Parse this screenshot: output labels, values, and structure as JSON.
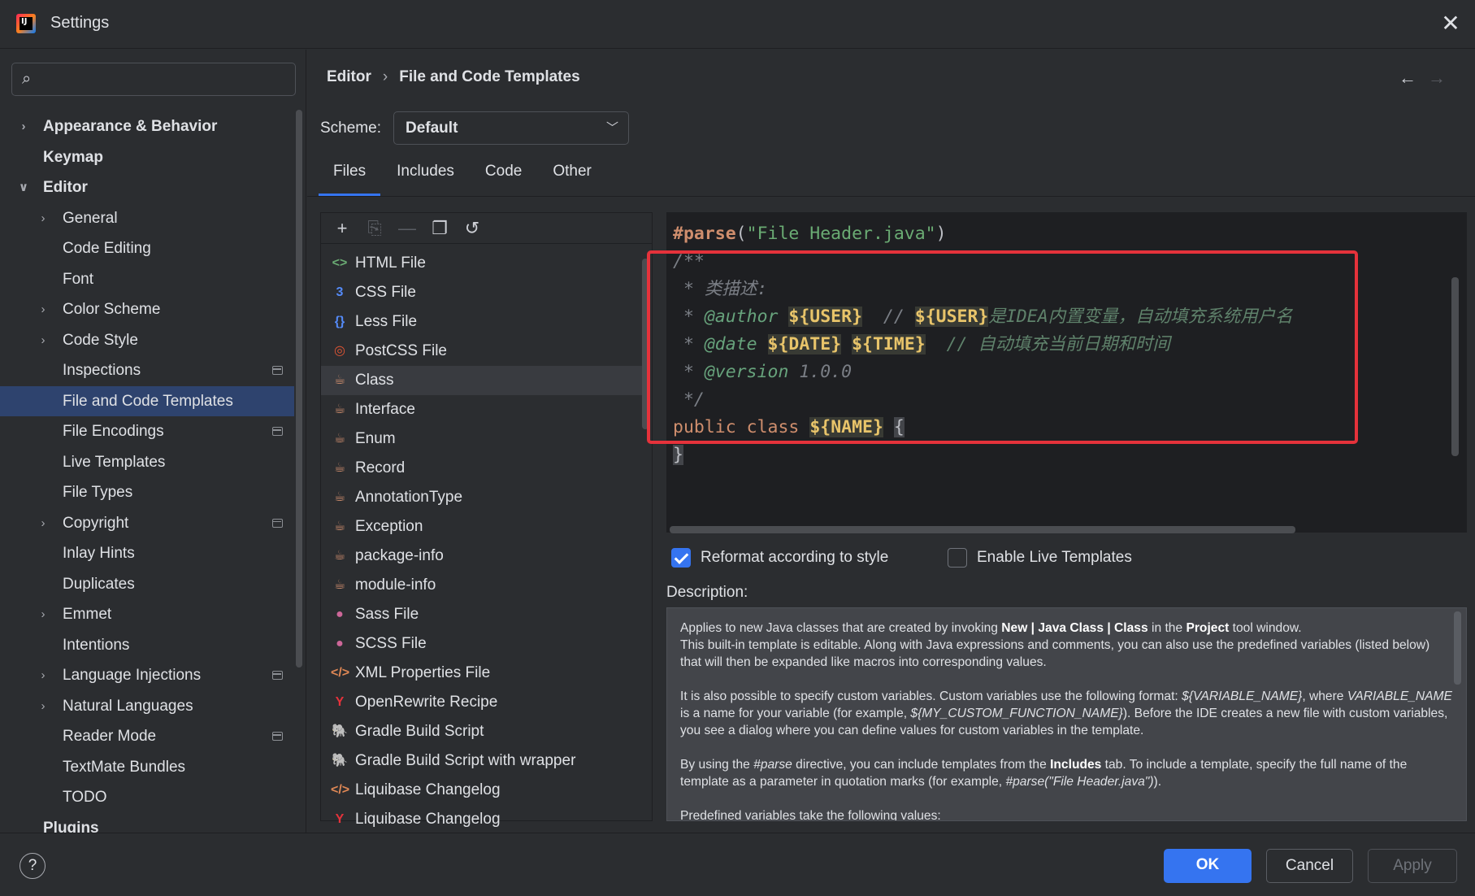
{
  "window": {
    "title": "Settings"
  },
  "search": {
    "placeholder": "",
    "value": ""
  },
  "sidebar": {
    "items": [
      {
        "label": "Appearance & Behavior",
        "level": 0,
        "expandable": true,
        "expanded": false,
        "bold": true
      },
      {
        "label": "Keymap",
        "level": 0,
        "expandable": false,
        "bold": true
      },
      {
        "label": "Editor",
        "level": 0,
        "expandable": true,
        "expanded": true,
        "bold": true
      },
      {
        "label": "General",
        "level": 1,
        "expandable": true
      },
      {
        "label": "Code Editing",
        "level": 1
      },
      {
        "label": "Font",
        "level": 1
      },
      {
        "label": "Color Scheme",
        "level": 1,
        "expandable": true
      },
      {
        "label": "Code Style",
        "level": 1,
        "expandable": true
      },
      {
        "label": "Inspections",
        "level": 1,
        "project_icon": true
      },
      {
        "label": "File and Code Templates",
        "level": 1,
        "selected": true
      },
      {
        "label": "File Encodings",
        "level": 1,
        "project_icon": true
      },
      {
        "label": "Live Templates",
        "level": 1
      },
      {
        "label": "File Types",
        "level": 1
      },
      {
        "label": "Copyright",
        "level": 1,
        "expandable": true,
        "project_icon": true
      },
      {
        "label": "Inlay Hints",
        "level": 1
      },
      {
        "label": "Duplicates",
        "level": 1
      },
      {
        "label": "Emmet",
        "level": 1,
        "expandable": true
      },
      {
        "label": "Intentions",
        "level": 1
      },
      {
        "label": "Language Injections",
        "level": 1,
        "expandable": true,
        "project_icon": true
      },
      {
        "label": "Natural Languages",
        "level": 1,
        "expandable": true
      },
      {
        "label": "Reader Mode",
        "level": 1,
        "project_icon": true
      },
      {
        "label": "TextMate Bundles",
        "level": 1
      },
      {
        "label": "TODO",
        "level": 1
      },
      {
        "label": "Plugins",
        "level": 0,
        "bold": true
      }
    ]
  },
  "breadcrumb": {
    "parent": "Editor",
    "separator": "›",
    "current": "File and Code Templates"
  },
  "scheme": {
    "label": "Scheme:",
    "value": "Default"
  },
  "tabs": [
    {
      "label": "Files",
      "active": true
    },
    {
      "label": "Includes"
    },
    {
      "label": "Code"
    },
    {
      "label": "Other"
    }
  ],
  "toolbar_icons": [
    "add-icon",
    "copy-template-icon",
    "remove-icon",
    "duplicate-icon",
    "reset-icon"
  ],
  "templates": [
    {
      "name": "HTML File",
      "icon": "html-icon",
      "glyph": "<>",
      "color": "#6aab73"
    },
    {
      "name": "CSS File",
      "icon": "css-icon",
      "glyph": "3",
      "color": "#548af7"
    },
    {
      "name": "Less File",
      "icon": "less-icon",
      "glyph": "{}",
      "color": "#548af7"
    },
    {
      "name": "PostCSS File",
      "icon": "postcss-icon",
      "glyph": "◎",
      "color": "#e05534"
    },
    {
      "name": "Class",
      "icon": "java-cup-icon",
      "glyph": "☕",
      "color": "#cf8e6d",
      "selected": true
    },
    {
      "name": "Interface",
      "icon": "java-cup-icon",
      "glyph": "☕",
      "color": "#cf8e6d"
    },
    {
      "name": "Enum",
      "icon": "java-cup-icon",
      "glyph": "☕",
      "color": "#cf8e6d"
    },
    {
      "name": "Record",
      "icon": "java-cup-icon",
      "glyph": "☕",
      "color": "#cf8e6d"
    },
    {
      "name": "AnnotationType",
      "icon": "java-cup-icon",
      "glyph": "☕",
      "color": "#cf8e6d"
    },
    {
      "name": "Exception",
      "icon": "java-cup-icon",
      "glyph": "☕",
      "color": "#cf8e6d"
    },
    {
      "name": "package-info",
      "icon": "java-cup-icon",
      "glyph": "☕",
      "color": "#cf8e6d"
    },
    {
      "name": "module-info",
      "icon": "java-cup-icon",
      "glyph": "☕",
      "color": "#cf8e6d"
    },
    {
      "name": "Sass File",
      "icon": "sass-icon",
      "glyph": "●",
      "color": "#cd6799"
    },
    {
      "name": "SCSS File",
      "icon": "scss-icon",
      "glyph": "●",
      "color": "#cd6799"
    },
    {
      "name": "XML Properties File",
      "icon": "xml-icon",
      "glyph": "</>",
      "color": "#e08855"
    },
    {
      "name": "OpenRewrite Recipe",
      "icon": "openrewrite-icon",
      "glyph": "Y",
      "color": "#e5323b"
    },
    {
      "name": "Gradle Build Script",
      "icon": "gradle-icon",
      "glyph": "🐘",
      "color": "#bcbec4"
    },
    {
      "name": "Gradle Build Script with wrapper",
      "icon": "gradle-icon",
      "glyph": "🐘",
      "color": "#bcbec4"
    },
    {
      "name": "Liquibase Changelog",
      "icon": "xml-icon",
      "glyph": "</>",
      "color": "#e08855"
    },
    {
      "name": "Liquibase Changelog",
      "icon": "liquibase-icon",
      "glyph": "Y",
      "color": "#e5323b"
    }
  ],
  "code": {
    "line1": {
      "directive": "#parse",
      "open": "(",
      "string": "\"File Header.java\"",
      "close": ")"
    },
    "line2": "/**",
    "line3": " * 类描述:",
    "line4": {
      "prefix": " * ",
      "tag": "@author",
      "var1": "${USER}",
      "mid": "  // ",
      "var2": "${USER}",
      "comment": "是IDEA内置变量，自动填充系统用户名"
    },
    "line5": {
      "prefix": " * ",
      "tag": "@date",
      "var1": "${DATE}",
      "var2": "${TIME}",
      "comment": "  // 自动填充当前日期和时间"
    },
    "line6": {
      "prefix": " * ",
      "tag": "@version",
      "value": " 1.0.0"
    },
    "line7": " */",
    "line8": {
      "kw1": "public",
      "kw2": "class",
      "var": "${NAME}",
      "brace": "{"
    },
    "line9": "}"
  },
  "options": {
    "reformat": {
      "label": "Reformat according to style",
      "checked": true
    },
    "live_templates": {
      "label": "Enable Live Templates",
      "checked": false
    }
  },
  "description": {
    "label": "Description:",
    "p1a": "Applies to new Java classes that are created by invoking ",
    "p1b": "New | Java Class | Class",
    "p1c": " in the ",
    "p1d": "Project",
    "p1e": " tool window.",
    "p1f": "This built-in template is editable. Along with Java expressions and comments, you can also use the predefined variables (listed below) that will then be expanded like macros into corresponding values.",
    "p2a": "It is also possible to specify custom variables. Custom variables use the following format: ",
    "p2b": "${VARIABLE_NAME}",
    "p2c": ", where ",
    "p2d": "VARIABLE_NAME",
    "p2e": " is a name for your variable (for example, ",
    "p2f": "${MY_CUSTOM_FUNCTION_NAME}",
    "p2g": "). Before the IDE creates a new file with custom variables, you see a dialog where you can define values for custom variables in the template.",
    "p3a": "By using the ",
    "p3b": "#parse",
    "p3c": " directive, you can include templates from the ",
    "p3d": "Includes",
    "p3e": " tab. To include a template, specify the full name of the template as a parameter in quotation marks (for example, ",
    "p3f": "#parse(\"File Header.java\")",
    "p3g": ").",
    "p4": "Predefined variables take the following values:"
  },
  "footer": {
    "help": "?",
    "ok": "OK",
    "cancel": "Cancel",
    "apply": "Apply"
  },
  "colors": {
    "accent": "#3574f0",
    "selection": "#2e436e",
    "highlight_box": "#e5323b"
  }
}
